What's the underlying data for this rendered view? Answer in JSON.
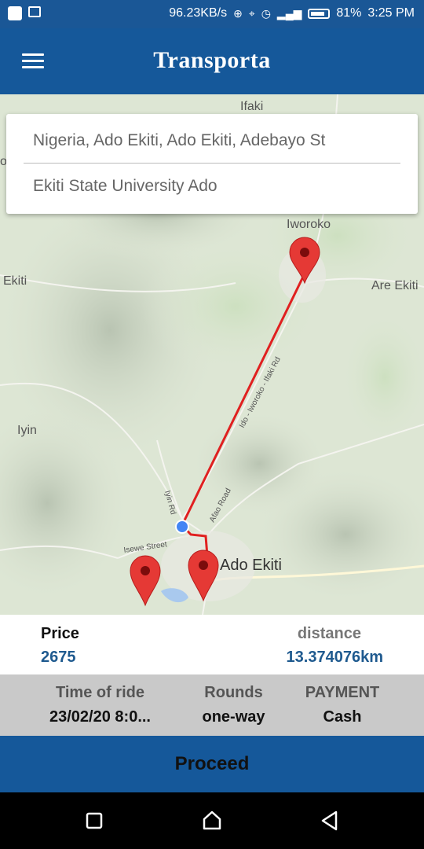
{
  "status_bar": {
    "speed": "96.23KB/s",
    "battery": "81%",
    "time": "3:25 PM"
  },
  "app": {
    "title": "Transporta"
  },
  "route": {
    "from": "Nigeria, Ado Ekiti, Ado Ekiti, Adebayo St",
    "to": "Ekiti State University Ado"
  },
  "map": {
    "labels": {
      "ifaki": "Ifaki",
      "iworoko": "Iworoko",
      "are_ekiti": "Are Ekiti",
      "ekiti": "Ekiti",
      "iyin": "Iyin",
      "road_iworoko": "Ido - Iworoko - Ifaki Rd",
      "iyin_rd": "Iyin Rd",
      "afao_road": "Afao Road",
      "isewe_street": "Isewe Street",
      "ado_ekiti": "Ado Ekiti",
      "edge_o": "o"
    },
    "route_color": "#e02020",
    "marker_color": "#e53935"
  },
  "trip": {
    "price_label": "Price",
    "price_value": "2675",
    "distance_label": "distance",
    "distance_value": "13.374076km"
  },
  "details": {
    "time_label": "Time of ride",
    "time_value": "23/02/20 8:0...",
    "rounds_label": "Rounds",
    "rounds_value": "one-way",
    "payment_label": "PAYMENT",
    "payment_value": "Cash"
  },
  "actions": {
    "proceed": "Proceed"
  },
  "colors": {
    "primary": "#15589a",
    "value_blue": "#1f5a8f"
  }
}
